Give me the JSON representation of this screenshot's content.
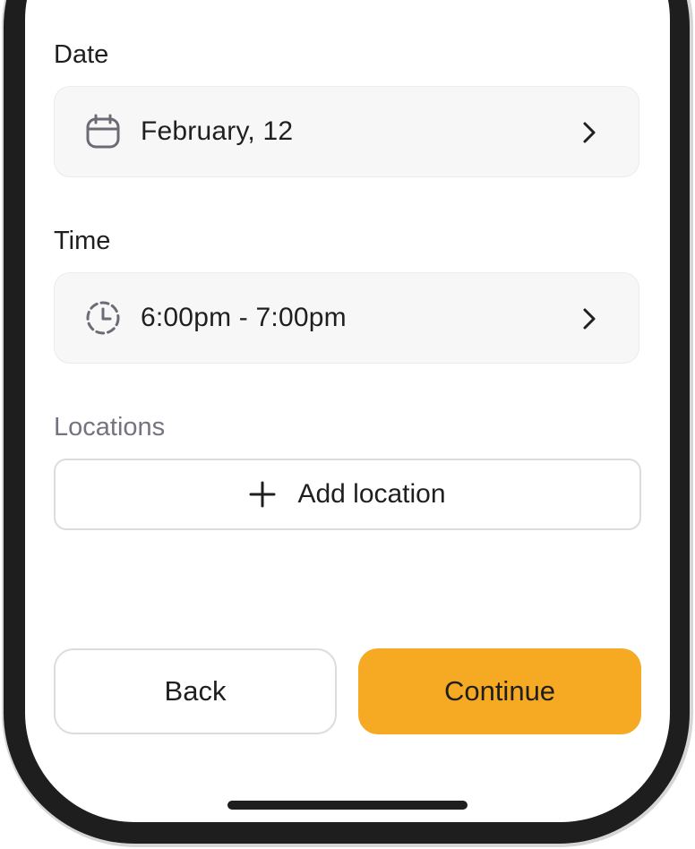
{
  "date": {
    "label": "Date",
    "value": "February, 12",
    "icon": "calendar-icon"
  },
  "time": {
    "label": "Time",
    "value": "6:00pm - 7:00pm",
    "icon": "clock-icon"
  },
  "locations": {
    "label": "Locations",
    "add_label": "Add location"
  },
  "actions": {
    "back_label": "Back",
    "continue_label": "Continue"
  },
  "colors": {
    "accent": "#F6AA23",
    "field_bg": "#F7F7F7",
    "muted_label": "#747480"
  }
}
